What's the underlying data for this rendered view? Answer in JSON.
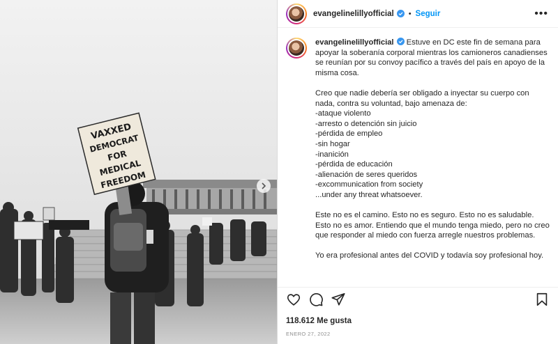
{
  "post": {
    "username": "evangelinelillyofficial",
    "follow_label": "Seguir",
    "separator": "•",
    "more_label": "•••",
    "sign_lines": [
      "VAXXED",
      "DEMOCRAT",
      "FOR",
      "MEDICAL",
      "FREEDOM"
    ],
    "caption": "Estuve en DC este fin de semana para apoyar la soberanía corporal mientras los camioneros canadienses se reunían por su convoy pacífico a través del país en apoyo de la misma cosa.\n\nCreo que nadie debería ser obligado a inyectar su cuerpo con nada, contra su voluntad, bajo amenaza de:\n-ataque violento\n-arresto o detención sin juicio\n-pérdida de empleo\n-sin hogar\n-inanición\n-pérdida de educación\n-alienación de seres queridos\n-excommunication from society\n...under any threat whatsoever.\n\nEste no es el camino. Esto no es seguro. Esto no es saludable. Esto no es amor. Entiendo que el mundo tenga miedo, pero no creo que responder al miedo con fuerza arregle nuestros problemas.\n\nYo era profesional antes del COVID y todavía soy profesional hoy.",
    "likes": "118.612 Me gusta",
    "date": "ENERO 27, 2022"
  },
  "icons": {
    "like": "heart-icon",
    "comment": "comment-icon",
    "share": "share-icon",
    "save": "bookmark-icon",
    "verified": "verified-badge-icon",
    "carousel": "chevron-right-icon"
  },
  "colors": {
    "link": "#0095f6",
    "verified": "#3897f0",
    "text": "#262626",
    "muted": "#8e8e8e"
  }
}
